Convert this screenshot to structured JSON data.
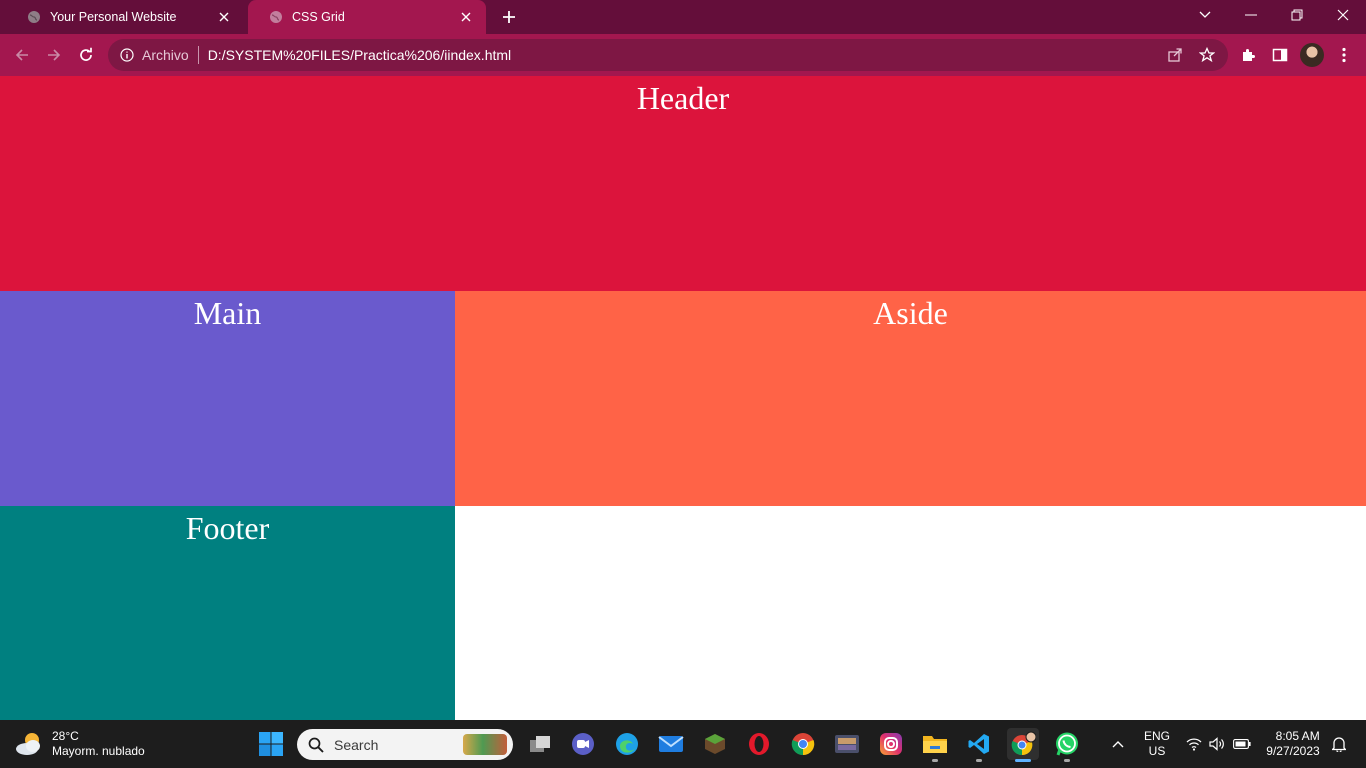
{
  "browser": {
    "tabs": [
      {
        "title": "Your Personal Website",
        "active": false
      },
      {
        "title": "CSS Grid",
        "active": true
      }
    ],
    "address": {
      "scheme_label": "Archivo",
      "url": "D:/SYSTEM%20FILES/Practica%206/iindex.html"
    }
  },
  "page": {
    "header": "Header",
    "main": "Main",
    "aside": "Aside",
    "footer": "Footer"
  },
  "colors": {
    "header": "#dc143c",
    "main": "#6a5acd",
    "aside": "#ff6347",
    "footer": "#008080",
    "chrome_frame": "#640e3a",
    "chrome_toolbar": "#a3174f"
  },
  "taskbar": {
    "weather": {
      "temp": "28°C",
      "desc": "Mayorm. nublado"
    },
    "search_placeholder": "Search",
    "apps": [
      "task-view",
      "teams-chat",
      "edge",
      "mail",
      "minecraft",
      "opera",
      "chrome",
      "game",
      "instagram",
      "file-explorer",
      "vscode",
      "chrome-profile",
      "whatsapp"
    ],
    "language": {
      "line1": "ENG",
      "line2": "US"
    },
    "clock": {
      "time": "8:05 AM",
      "date": "9/27/2023"
    }
  }
}
